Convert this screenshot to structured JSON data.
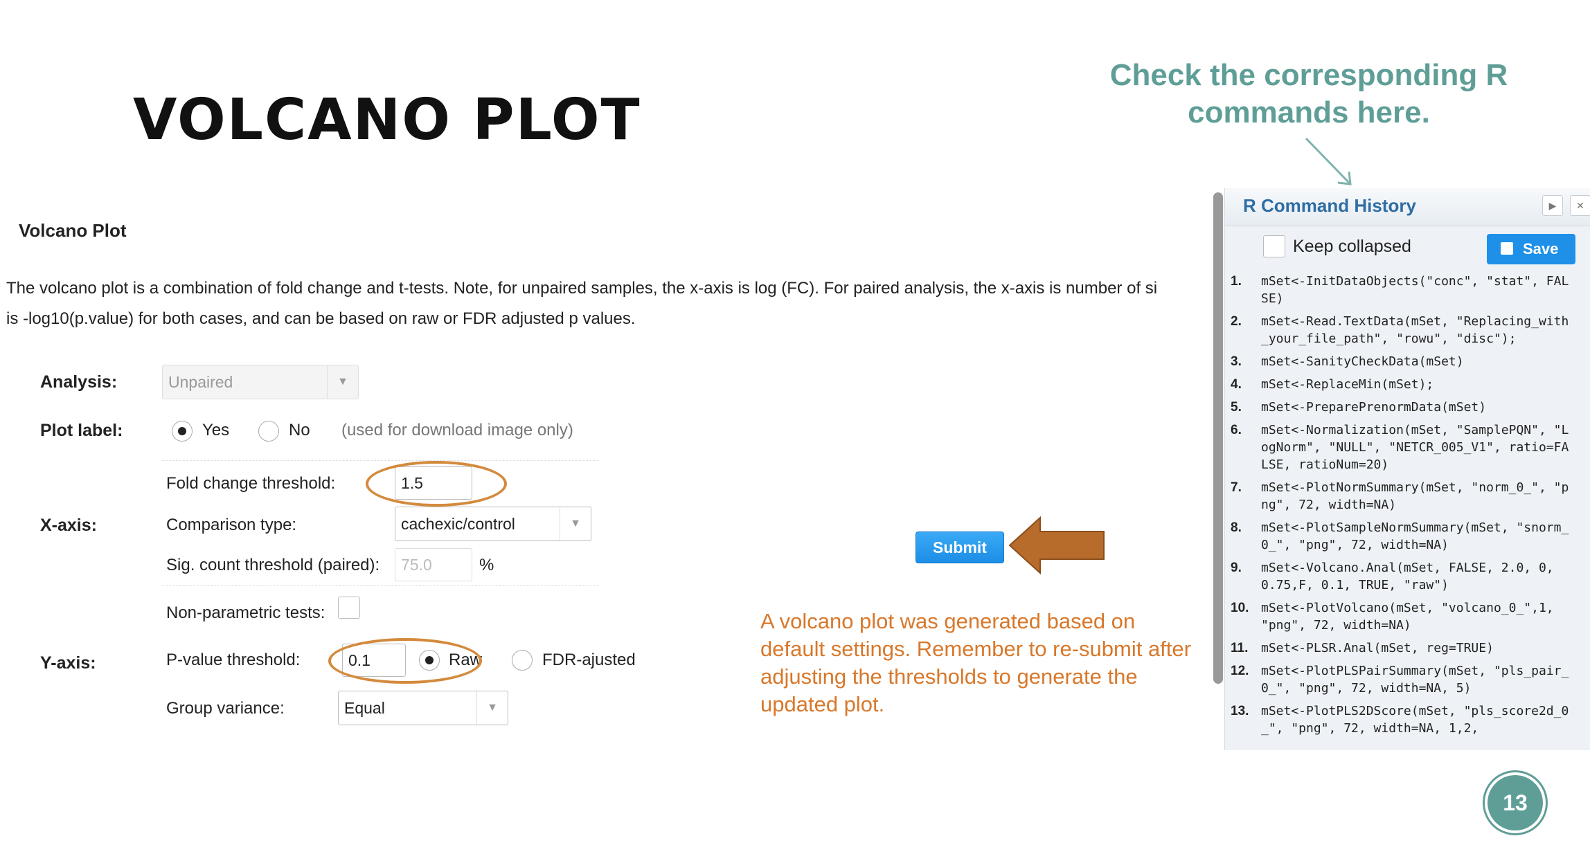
{
  "slide": {
    "title": "VOLCANO PLOT",
    "callout": "Check the corresponding R commands here.",
    "page_number": "13"
  },
  "section": {
    "title": "Volcano Plot",
    "description_line1": "The volcano plot is a combination of fold change and t-tests. Note, for unpaired samples, the x-axis is log (FC). For paired analysis, the x-axis is number of si",
    "description_line2": "is -log10(p.value) for both cases, and can be based on raw or FDR adjusted p values."
  },
  "form": {
    "analysis": {
      "label": "Analysis:",
      "value": "Unpaired"
    },
    "plot_label": {
      "label": "Plot label:",
      "yes": "Yes",
      "no": "No",
      "note": "(used for download image only)",
      "selected": "Yes"
    },
    "x_axis": {
      "label": "X-axis:",
      "fold_change_label": "Fold change threshold:",
      "fold_change_value": "1.5",
      "comparison_label": "Comparison type:",
      "comparison_value": "cachexic/control",
      "sig_count_label": "Sig. count threshold (paired):",
      "sig_count_value": "75.0",
      "sig_count_unit": "%"
    },
    "non_parametric_label": "Non-parametric tests:",
    "y_axis": {
      "label": "Y-axis:",
      "pvalue_label": "P-value threshold:",
      "pvalue_value": "0.1",
      "raw_label": "Raw",
      "fdr_label": "FDR-ajusted",
      "selected": "Raw",
      "group_variance_label": "Group variance:",
      "group_variance_value": "Equal"
    },
    "submit_label": "Submit"
  },
  "note": "A volcano plot was generated based on default settings. Remember to re-submit after adjusting the thresholds to generate the updated plot.",
  "r_panel": {
    "title": "R Command History",
    "keep_collapsed_label": "Keep collapsed",
    "save_label": "Save",
    "commands": [
      {
        "num": "1.",
        "text": "mSet<-InitDataObjects(\"conc\", \"stat\", FALSE)"
      },
      {
        "num": "2.",
        "text": "mSet<-Read.TextData(mSet, \"Replacing_with_your_file_path\", \"rowu\", \"disc\");"
      },
      {
        "num": "3.",
        "text": "mSet<-SanityCheckData(mSet)"
      },
      {
        "num": "4.",
        "text": "mSet<-ReplaceMin(mSet);"
      },
      {
        "num": "5.",
        "text": "mSet<-PreparePrenormData(mSet)"
      },
      {
        "num": "6.",
        "text": "mSet<-Normalization(mSet, \"SamplePQN\", \"LogNorm\", \"NULL\", \"NETCR_005_V1\", ratio=FALSE, ratioNum=20)"
      },
      {
        "num": "7.",
        "text": "mSet<-PlotNormSummary(mSet, \"norm_0_\", \"png\", 72, width=NA)"
      },
      {
        "num": "8.",
        "text": "mSet<-PlotSampleNormSummary(mSet, \"snorm_0_\", \"png\", 72, width=NA)"
      },
      {
        "num": "9.",
        "text": "mSet<-Volcano.Anal(mSet, FALSE, 2.0, 0, 0.75,F, 0.1, TRUE, \"raw\")"
      },
      {
        "num": "10.",
        "text": "mSet<-PlotVolcano(mSet, \"volcano_0_\",1, \"png\", 72, width=NA)"
      },
      {
        "num": "11.",
        "text": "mSet<-PLSR.Anal(mSet, reg=TRUE)"
      },
      {
        "num": "12.",
        "text": "mSet<-PlotPLSPairSummary(mSet, \"pls_pair_0_\", \"png\", 72, width=NA, 5)"
      },
      {
        "num": "13.",
        "text": "mSet<-PlotPLS2DScore(mSet, \"pls_score2d_0_\", \"png\", 72, width=NA, 1,2,"
      }
    ]
  },
  "colors": {
    "teal": "#5f9e97",
    "orange": "#d8782b",
    "button_blue": "#1e90e8",
    "panel_title_blue": "#2e6da4"
  }
}
